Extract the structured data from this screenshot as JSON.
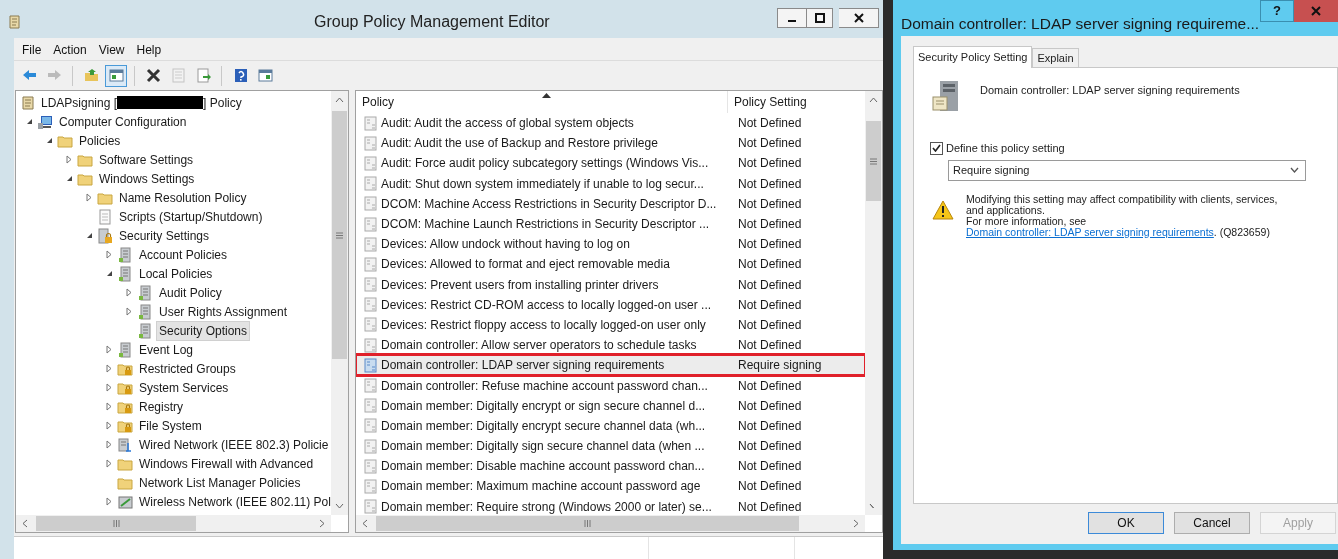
{
  "main_window": {
    "title": "Group Policy Management Editor",
    "menu": [
      "File",
      "Action",
      "View",
      "Help"
    ],
    "toolbar": [
      {
        "kind": "back",
        "pressed": false,
        "disabled": false
      },
      {
        "kind": "forward",
        "pressed": false,
        "disabled": true
      },
      {
        "kind": "up",
        "pressed": false,
        "disabled": false
      },
      {
        "kind": "tree",
        "pressed": true,
        "disabled": false
      },
      {
        "kind": "delete",
        "pressed": false,
        "disabled": false
      },
      {
        "kind": "properties",
        "pressed": false,
        "disabled": true
      },
      {
        "kind": "export",
        "pressed": false,
        "disabled": false
      },
      {
        "kind": "help",
        "pressed": false,
        "disabled": false
      },
      {
        "kind": "panel",
        "pressed": false,
        "disabled": false
      }
    ],
    "tree": {
      "label_before": "LDAPsigning [",
      "label_after": "] Policy",
      "redacted": true,
      "selected": false,
      "children": [
        {
          "label": "Computer Configuration",
          "kind": "computer",
          "expandable": true,
          "expanded": true,
          "selected": false,
          "children": [
            {
              "label": "Policies",
              "kind": "folder",
              "expandable": true,
              "expanded": true,
              "selected": false,
              "children": [
                {
                  "label": "Software Settings",
                  "kind": "folder",
                  "expandable": true,
                  "expanded": false,
                  "selected": false
                },
                {
                  "label": "Windows Settings",
                  "kind": "folder",
                  "expandable": true,
                  "expanded": true,
                  "selected": false,
                  "children": [
                    {
                      "label": "Name Resolution Policy",
                      "kind": "folder",
                      "expandable": true,
                      "expanded": false,
                      "selected": false
                    },
                    {
                      "label": "Scripts (Startup/Shutdown)",
                      "kind": "script",
                      "expandable": false,
                      "selected": false
                    },
                    {
                      "label": "Security Settings",
                      "kind": "security",
                      "expandable": true,
                      "expanded": true,
                      "selected": false,
                      "children": [
                        {
                          "label": "Account Policies",
                          "kind": "policy",
                          "expandable": true,
                          "expanded": false,
                          "selected": false
                        },
                        {
                          "label": "Local Policies",
                          "kind": "policy",
                          "expandable": true,
                          "expanded": true,
                          "selected": false,
                          "children": [
                            {
                              "label": "Audit Policy",
                              "kind": "policy",
                              "expandable": true,
                              "expanded": false,
                              "selected": false
                            },
                            {
                              "label": "User Rights Assignment",
                              "kind": "policy",
                              "expandable": true,
                              "expanded": false,
                              "selected": false
                            },
                            {
                              "label": "Security Options",
                              "kind": "policy",
                              "expandable": false,
                              "selected": true
                            }
                          ]
                        },
                        {
                          "label": "Event Log",
                          "kind": "policy",
                          "expandable": true,
                          "expanded": false,
                          "selected": false
                        },
                        {
                          "label": "Restricted Groups",
                          "kind": "locked-folder",
                          "expandable": true,
                          "expanded": false,
                          "selected": false
                        },
                        {
                          "label": "System Services",
                          "kind": "locked-folder",
                          "expandable": true,
                          "expanded": false,
                          "selected": false
                        },
                        {
                          "label": "Registry",
                          "kind": "locked-folder",
                          "expandable": true,
                          "expanded": false,
                          "selected": false
                        },
                        {
                          "label": "File System",
                          "kind": "locked-folder",
                          "expandable": true,
                          "expanded": false,
                          "selected": false
                        },
                        {
                          "label": "Wired Network (IEEE 802.3) Policie",
                          "kind": "network",
                          "expandable": true,
                          "expanded": false,
                          "selected": false
                        },
                        {
                          "label": "Windows Firewall with Advanced",
                          "kind": "folder",
                          "expandable": true,
                          "expanded": false,
                          "selected": false
                        },
                        {
                          "label": "Network List Manager Policies",
                          "kind": "folder",
                          "expandable": false,
                          "selected": false
                        },
                        {
                          "label": "Wireless Network (IEEE 802.11) Pol",
                          "kind": "wireless",
                          "expandable": true,
                          "expanded": false,
                          "selected": false
                        }
                      ]
                    }
                  ]
                }
              ]
            }
          ]
        }
      ]
    },
    "policies": {
      "columns": [
        {
          "label": "Policy",
          "sorted": true
        },
        {
          "label": "Policy Setting",
          "sorted": false
        }
      ],
      "rows": [
        {
          "policy": "Audit: Audit the access of global system objects",
          "setting": "Not Defined",
          "selected": false,
          "outlined": false
        },
        {
          "policy": "Audit: Audit the use of Backup and Restore privilege",
          "setting": "Not Defined",
          "selected": false,
          "outlined": false
        },
        {
          "policy": "Audit: Force audit policy subcategory settings (Windows Vis...",
          "setting": "Not Defined",
          "selected": false,
          "outlined": false
        },
        {
          "policy": "Audit: Shut down system immediately if unable to log secur...",
          "setting": "Not Defined",
          "selected": false,
          "outlined": false
        },
        {
          "policy": "DCOM: Machine Access Restrictions in Security Descriptor D...",
          "setting": "Not Defined",
          "selected": false,
          "outlined": false
        },
        {
          "policy": "DCOM: Machine Launch Restrictions in Security Descriptor ...",
          "setting": "Not Defined",
          "selected": false,
          "outlined": false
        },
        {
          "policy": "Devices: Allow undock without having to log on",
          "setting": "Not Defined",
          "selected": false,
          "outlined": false
        },
        {
          "policy": "Devices: Allowed to format and eject removable media",
          "setting": "Not Defined",
          "selected": false,
          "outlined": false
        },
        {
          "policy": "Devices: Prevent users from installing printer drivers",
          "setting": "Not Defined",
          "selected": false,
          "outlined": false
        },
        {
          "policy": "Devices: Restrict CD-ROM access to locally logged-on user ...",
          "setting": "Not Defined",
          "selected": false,
          "outlined": false
        },
        {
          "policy": "Devices: Restrict floppy access to locally logged-on user only",
          "setting": "Not Defined",
          "selected": false,
          "outlined": false
        },
        {
          "policy": "Domain controller: Allow server operators to schedule tasks",
          "setting": "Not Defined",
          "selected": false,
          "outlined": false
        },
        {
          "policy": "Domain controller: LDAP server signing requirements",
          "setting": "Require signing",
          "selected": true,
          "outlined": true
        },
        {
          "policy": "Domain controller: Refuse machine account password chan...",
          "setting": "Not Defined",
          "selected": false,
          "outlined": false
        },
        {
          "policy": "Domain member: Digitally encrypt or sign secure channel d...",
          "setting": "Not Defined",
          "selected": false,
          "outlined": false
        },
        {
          "policy": "Domain member: Digitally encrypt secure channel data (wh...",
          "setting": "Not Defined",
          "selected": false,
          "outlined": false
        },
        {
          "policy": "Domain member: Digitally sign secure channel data (when ...",
          "setting": "Not Defined",
          "selected": false,
          "outlined": false
        },
        {
          "policy": "Domain member: Disable machine account password chan...",
          "setting": "Not Defined",
          "selected": false,
          "outlined": false
        },
        {
          "policy": "Domain member: Maximum machine account password age",
          "setting": "Not Defined",
          "selected": false,
          "outlined": false
        },
        {
          "policy": "Domain member: Require strong (Windows 2000 or later) se...",
          "setting": "Not Defined",
          "selected": false,
          "outlined": false
        }
      ]
    }
  },
  "dialog": {
    "title": "Domain controller: LDAP server signing requireme...",
    "help_button": "?",
    "tabs": [
      {
        "label": "Security Policy Setting",
        "selected": true
      },
      {
        "label": "Explain",
        "selected": false
      }
    ],
    "heading": "Domain controller: LDAP server signing requirements",
    "define_checkbox": {
      "label": "Define this policy setting",
      "checked": true
    },
    "dropdown": {
      "value": "Require signing"
    },
    "warning": "Modifying this setting may affect compatibility with clients, services, and applications.",
    "more_info_prefix": "For more information, see ",
    "link": "Domain controller: LDAP server signing requirements",
    "more_info_suffix": ". (Q823659)",
    "buttons": [
      {
        "label": "OK",
        "default": true,
        "disabled": false
      },
      {
        "label": "Cancel",
        "default": false,
        "disabled": false
      },
      {
        "label": "Apply",
        "default": false,
        "disabled": true
      }
    ]
  }
}
